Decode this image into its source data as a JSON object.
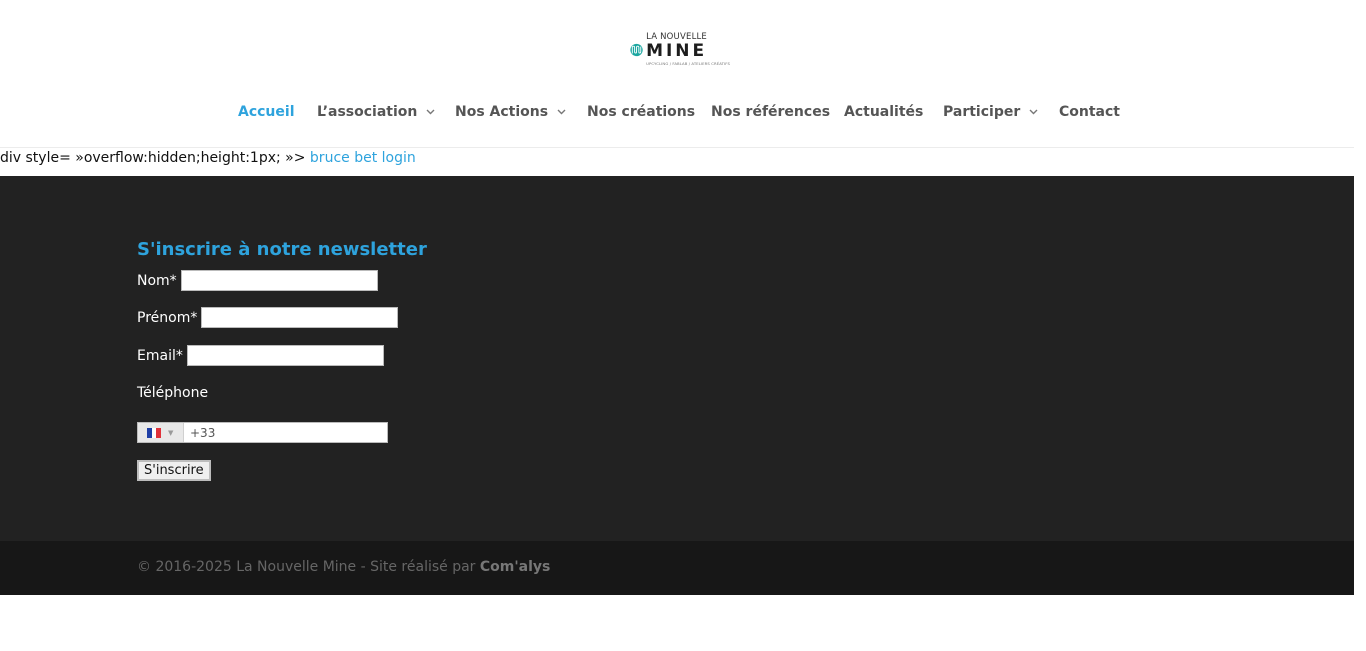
{
  "header": {
    "logo": {
      "small": "LA NOUVELLE",
      "big": "MINE",
      "tagline": "UPCYCLING / FABLAB / ATELIERS CRÉATIFS",
      "brand_color": "#1aa6a0"
    },
    "nav": [
      {
        "label": "Accueil",
        "active": true,
        "has_dropdown": false
      },
      {
        "label": "L’association",
        "active": false,
        "has_dropdown": true
      },
      {
        "label": "Nos Actions",
        "active": false,
        "has_dropdown": true
      },
      {
        "label": "Nos créations",
        "active": false,
        "has_dropdown": false
      },
      {
        "label": "Nos références",
        "active": false,
        "has_dropdown": false
      },
      {
        "label": "Actualités",
        "active": false,
        "has_dropdown": false
      },
      {
        "label": "Participer",
        "active": false,
        "has_dropdown": true
      },
      {
        "label": "Contact",
        "active": false,
        "has_dropdown": false
      }
    ]
  },
  "injected": {
    "prefix": "div style= »overflow:hidden;height:1px; »> ",
    "link": "bruce bet login"
  },
  "newsletter": {
    "title": "S'inscrire à notre newsletter",
    "nom_label": "Nom*",
    "nom_value": "",
    "prenom_label": "Prénom*",
    "prenom_value": "",
    "email_label": "Email*",
    "email_value": "",
    "phone_label": "Téléphone",
    "phone_country": "France",
    "phone_value": "+33",
    "submit_label": "S'inscrire"
  },
  "footer": {
    "copyright": "© 2016-2025 La Nouvelle Mine - Site réalisé par ",
    "credit": "Com'alys"
  },
  "colors": {
    "accent": "#2ea3dd",
    "footer_bg": "#222222",
    "bottom_bar_bg": "#171717"
  }
}
